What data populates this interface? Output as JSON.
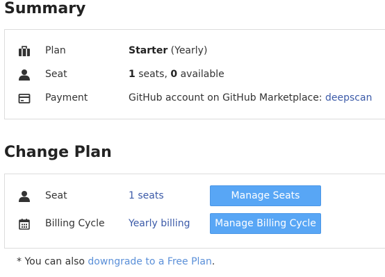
{
  "summary": {
    "title": "Summary",
    "plan": {
      "label": "Plan",
      "name": "Starter",
      "cycle": " (Yearly)",
      "icon": "briefcase-icon"
    },
    "seat": {
      "label": "Seat",
      "used": "1",
      "used_suffix": " seats, ",
      "available": "0",
      "available_suffix": " available",
      "icon": "person-icon"
    },
    "payment": {
      "label": "Payment",
      "text": "GitHub account on GitHub Marketplace: ",
      "link": "deepscan",
      "icon": "credit-card-icon"
    }
  },
  "change_plan": {
    "title": "Change Plan",
    "seat": {
      "label": "Seat",
      "value": "1 seats",
      "button": "Manage Seats",
      "icon": "person-icon"
    },
    "billing": {
      "label": "Billing Cycle",
      "value": "Yearly billing",
      "button": "Manage Billing Cycle",
      "icon": "calendar-icon"
    }
  },
  "footnote": {
    "prefix": "* You can also ",
    "link": "downgrade to a Free Plan",
    "suffix": "."
  },
  "colors": {
    "button": "#58a6f5",
    "link": "#3b5aa8",
    "border": "#dcdcdc"
  }
}
